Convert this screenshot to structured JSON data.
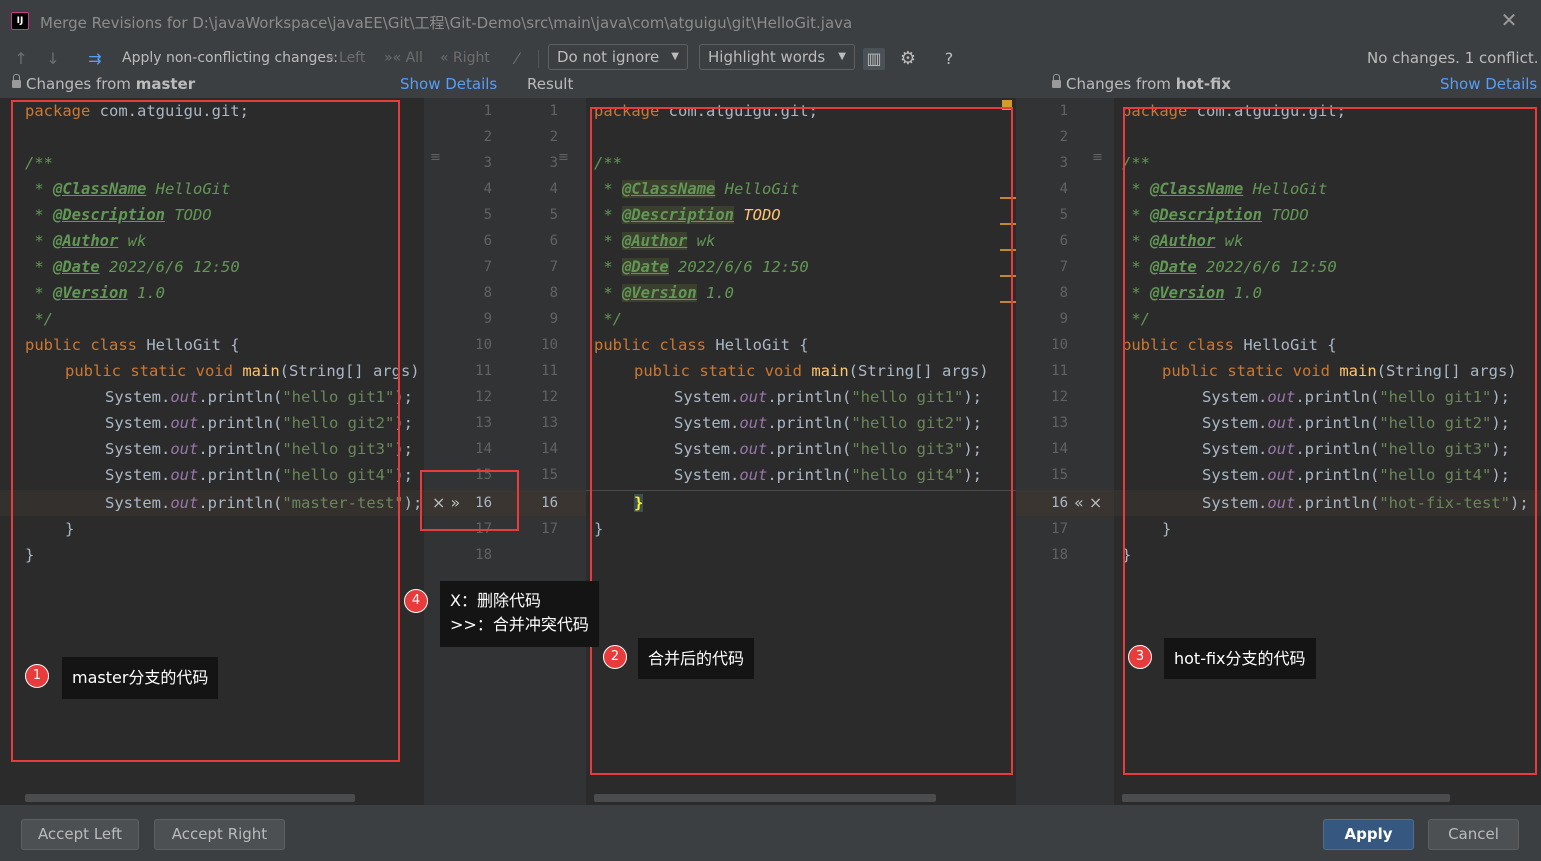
{
  "window": {
    "title": "Merge Revisions for D:\\javaWorkspace\\javaEE\\Git\\工程\\Git-Demo\\src\\main\\java\\com\\atguigu\\git\\HelloGit.java",
    "logo": "IJ"
  },
  "toolbar": {
    "apply_label": "Apply non-conflicting changes:",
    "left": "Left",
    "all": "All",
    "right": "Right",
    "ignore_combo": "Do not ignore",
    "highlight_combo": "Highlight words",
    "help": "?",
    "status": "No changes. 1 conflict."
  },
  "headers": {
    "left_title_prefix": "Changes from",
    "left_branch": "master",
    "show_details": "Show Details",
    "result": "Result",
    "right_title_prefix": "Changes from",
    "right_branch": "hot-fix"
  },
  "gutters": {
    "left_numbers": [
      "1",
      "2",
      "3",
      "4",
      "5",
      "6",
      "7",
      "8",
      "9",
      "10",
      "11",
      "12",
      "13",
      "14",
      "15",
      "16",
      "17",
      "18"
    ],
    "result_numbers": [
      "1",
      "2",
      "3",
      "4",
      "5",
      "6",
      "7",
      "8",
      "9",
      "10",
      "11",
      "12",
      "13",
      "14",
      "15",
      "16",
      "17"
    ],
    "right_numbers": [
      "1",
      "2",
      "3",
      "4",
      "5",
      "6",
      "7",
      "8",
      "9",
      "10",
      "11",
      "12",
      "13",
      "14",
      "15",
      "16",
      "17",
      "18"
    ],
    "left_conflict_controls": "× »",
    "right_conflict_controls": "« ×"
  },
  "code": {
    "package_kw": "package",
    "package_name": " com.atguigu.git;",
    "doc_open": "/**",
    "class_tag": "@ClassName",
    "class_val": " HelloGit",
    "desc_tag": "@Description",
    "desc_val": " TODO",
    "author_tag": "@Author",
    "author_val": " wk",
    "date_tag": "@Date",
    "date_val": " 2022/6/6 12:50",
    "version_tag": "@Version",
    "version_val": " 1.0",
    "doc_close": " */",
    "class_decl_kw": "public class",
    "class_decl_name": " HelloGit {",
    "main_kw": "public static void",
    "main_name": "main",
    "main_args": "(String[] args)",
    "sys": "System.",
    "out": "out",
    "println": ".println(",
    "str1": "\"hello git1\"",
    "str2": "\"hello git2\"",
    "str3": "\"hello git3\"",
    "str4": "\"hello git4\"",
    "master_str": "\"master-test\"",
    "hotfix_str": "\"hot-fix-test\"",
    "end_stmt": ");",
    "close_brace": "}"
  },
  "annotations": [
    {
      "num": "1",
      "text": "master分支的代码"
    },
    {
      "num": "2",
      "text": "合并后的代码"
    },
    {
      "num": "3",
      "text": "hot-fix分支的代码"
    },
    {
      "num": "4",
      "line1": "X：删除代码",
      "line2": ">>：合并冲突代码"
    }
  ],
  "buttons": {
    "accept_left": "Accept Left",
    "accept_right": "Accept Right",
    "apply": "Apply",
    "cancel": "Cancel"
  },
  "colors": {
    "annotation_red": "#e83b3b",
    "link_blue": "#589df6",
    "primary_button": "#365880"
  }
}
